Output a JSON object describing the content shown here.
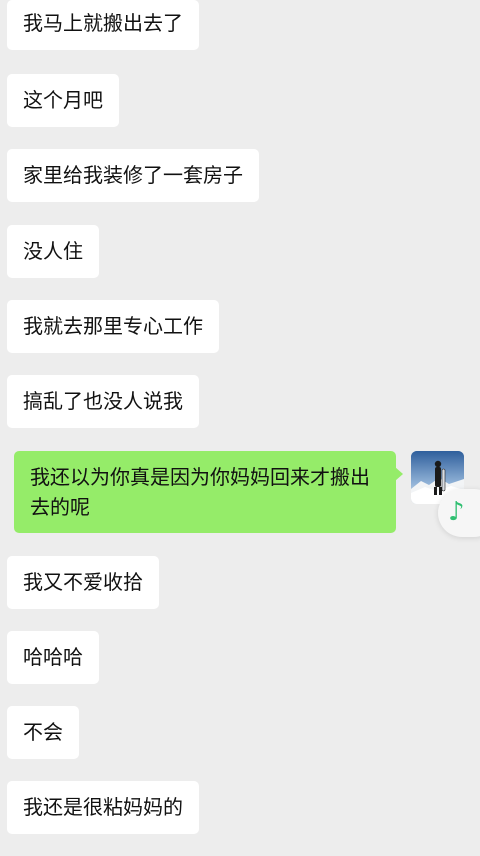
{
  "colors": {
    "background": "#ededed",
    "received_bubble": "#ffffff",
    "sent_bubble": "#95ec69",
    "music_note": "#2fbf71"
  },
  "messages": [
    {
      "side": "left",
      "text": "我马上就搬出去了"
    },
    {
      "side": "left",
      "text": "这个月吧"
    },
    {
      "side": "left",
      "text": "家里给我装修了一套房子"
    },
    {
      "side": "left",
      "text": "没人住"
    },
    {
      "side": "left",
      "text": "我就去那里专心工作"
    },
    {
      "side": "left",
      "text": "搞乱了也没人说我"
    },
    {
      "side": "right",
      "text": "我还以为你真是因为你妈妈回来才搬出去的呢"
    },
    {
      "side": "left",
      "text": "我又不爱收拾"
    },
    {
      "side": "left",
      "text": "哈哈哈"
    },
    {
      "side": "left",
      "text": "不会"
    },
    {
      "side": "left",
      "text": "我还是很粘妈妈的"
    }
  ],
  "icons": {
    "avatar": "user-avatar-snowboarder",
    "music": "music-note-icon"
  },
  "music_glyph": "♪"
}
